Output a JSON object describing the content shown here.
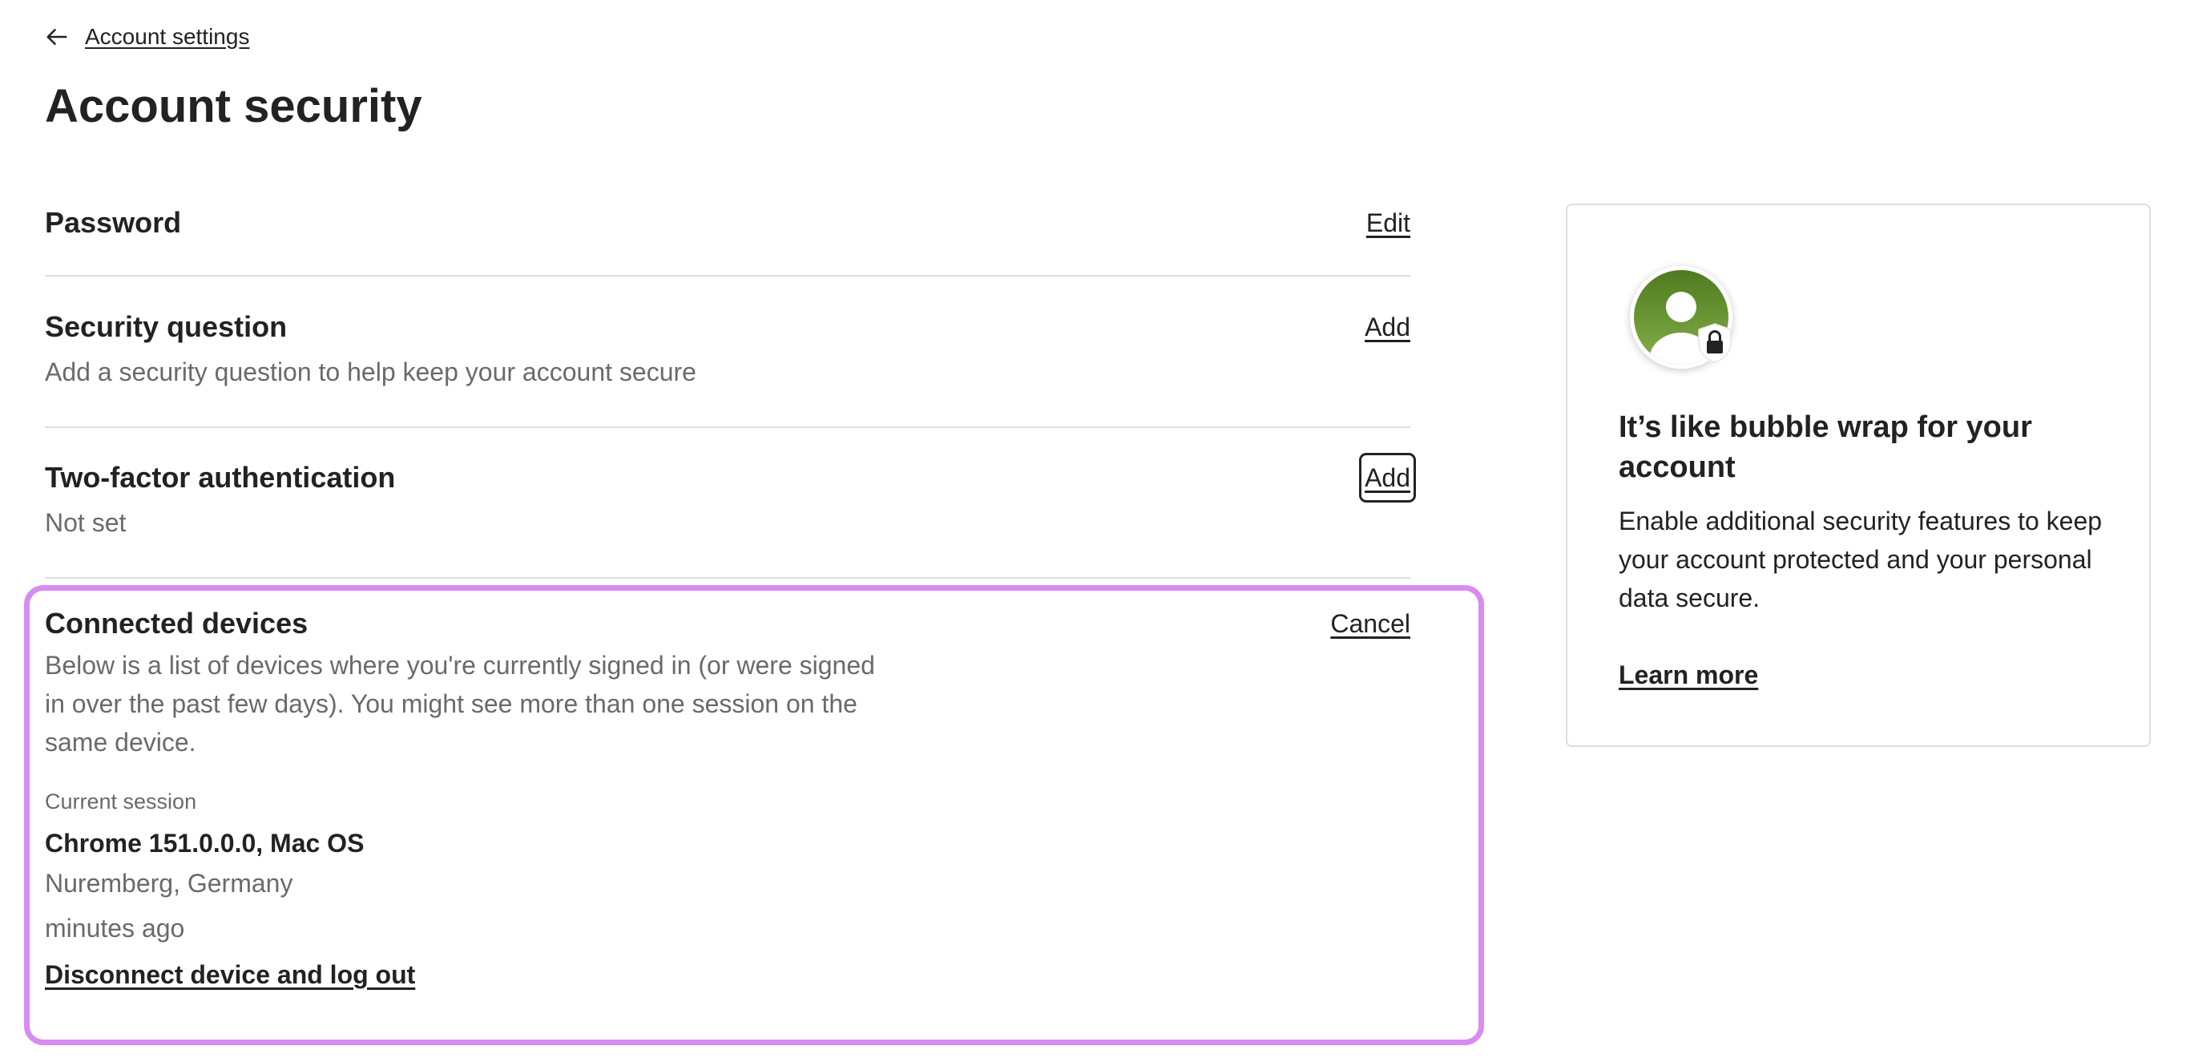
{
  "nav": {
    "back_label": "Account settings",
    "back_icon": "arrow-left-icon"
  },
  "page": {
    "title": "Account security"
  },
  "sections": {
    "password": {
      "title": "Password",
      "action": "Edit"
    },
    "security_question": {
      "title": "Security question",
      "description": "Add a security question to help keep your account secure",
      "action": "Add"
    },
    "two_factor": {
      "title": "Two-factor authentication",
      "description": "Not set",
      "action": "Add"
    },
    "connected_devices": {
      "title": "Connected devices",
      "action": "Cancel",
      "description": "Below is a list of devices where you're currently signed in (or were signed in over the past few days). You might see more than one session on the same device.",
      "current_session_label": "Current session",
      "device": "Chrome 151.0.0.0, Mac OS",
      "location": "Nuremberg, Germany",
      "last_active": "minutes ago",
      "disconnect_label": "Disconnect device and log out"
    }
  },
  "promo": {
    "icon": "user-lock-icon",
    "title": "It’s like bubble wrap for your account",
    "text": "Enable additional security features to keep your account protected and your personal data secure.",
    "link": "Learn more"
  },
  "colors": {
    "text_primary": "#222222",
    "text_secondary": "#6a6a6a",
    "divider": "#dddddd",
    "highlight": "#d88cf0",
    "avatar_green": "#5b8a2e"
  }
}
